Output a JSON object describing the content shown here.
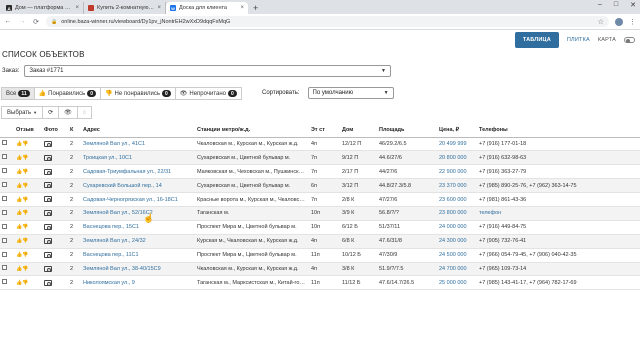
{
  "browser": {
    "tabs": [
      {
        "title": "Дом — платформа для просмотра",
        "color": "#2b2b2b",
        "glyph": "Д",
        "active": false
      },
      {
        "title": "Купить 2-комнатную квартиру",
        "color": "#c0392b",
        "glyph": "",
        "active": false
      },
      {
        "title": "Доска для клиента",
        "color": "#1a73e8",
        "glyph": "W",
        "active": true
      }
    ],
    "new_tab": "+",
    "url": "online.baza-winner.ru/viewboard/Dy1pv_jNontrEH2wXxD9dqqFxMqG",
    "window_controls": [
      "–",
      "□",
      "✕"
    ]
  },
  "nav": {
    "table_label": "ТАБЛИЦА",
    "tile_label": "ПЛИТКА",
    "map_label": "КАРТА"
  },
  "page_title": "СПИСОК ОБЪЕКТОВ",
  "order": {
    "label": "Заказ:",
    "value": "Заказ #1771"
  },
  "filters": [
    {
      "label": "Все",
      "count": "11",
      "icon": ""
    },
    {
      "label": "Понравились",
      "count": "0",
      "icon": "thumbs-up-icon"
    },
    {
      "label": "Не понравились",
      "count": "0",
      "icon": "thumbs-down-icon"
    },
    {
      "label": "Непрочитано",
      "count": "0",
      "icon": "eye-icon"
    }
  ],
  "sort": {
    "label": "Сортировать:",
    "value": "По умолчанию"
  },
  "actions": {
    "select_label": "Выбрать"
  },
  "table": {
    "headers": [
      "",
      "Отзыв",
      "Фото",
      "К",
      "Адрес",
      "Станции метро/ж.д.",
      "Эт ст",
      "Дом",
      "Площадь",
      "Цена, ₽",
      "Телефоны"
    ],
    "rows": [
      {
        "k": "2",
        "address": "Земляной Вал ул., 41С1",
        "metro": "Чкаловская м., Курская м., Курская ж.д.",
        "floor": "4п",
        "house": "12/12 П",
        "area": "46/29.2/6.5",
        "price": "20 499 999",
        "phones": "+7 (916) 177-01-18"
      },
      {
        "k": "2",
        "address": "Троицкая ул., 10С1",
        "metro": "Сухаревская м., Цветной бульвар м.",
        "floor": "7п",
        "house": "9/12 П",
        "area": "44.6/27/6",
        "price": "20 800 000",
        "phones": "+7 (916) 632-98-63"
      },
      {
        "k": "2",
        "address": "Садовая-Триумфальная ул., 22/31",
        "metro": "Маяковская м., Чеховская м., Пушкинская м.",
        "floor": "7п",
        "house": "2/17 П",
        "area": "44/27/6",
        "price": "22 900 000",
        "phones": "+7 (916) 363-27-79"
      },
      {
        "k": "2",
        "address": "Сухаревский Большой пер., 14",
        "metro": "Сухаревская м., Цветной бульвар м.",
        "floor": "6п",
        "house": "3/12 П",
        "area": "44.8/27.3/5.8",
        "price": "23 370 000",
        "phones": "+7 (985) 890-25-76, +7 (962) 363-14-75"
      },
      {
        "k": "2",
        "address": "Садовая-Черногрязская ул., 16-18С1",
        "metro": "Красные ворота м., Курская м., Чкаловская м.",
        "floor": "7п",
        "house": "2/8 К",
        "area": "47/27/6",
        "price": "23 600 000",
        "phones": "+7 (981) 861-43-36"
      },
      {
        "k": "2",
        "address": "Земляной Вал ул., 52/16С2",
        "metro": "Таганская м.",
        "floor": "10п",
        "house": "3/9 К",
        "area": "56.8/?/?",
        "price": "23 800 000",
        "phones": "телефон"
      },
      {
        "k": "2",
        "address": "Васнецова пер., 15С1",
        "metro": "Проспект Мира м., Цветной бульвар м.",
        "floor": "10п",
        "house": "6/12 Б",
        "area": "51/37/11",
        "price": "24 000 000",
        "phones": "+7 (916) 449-84-75"
      },
      {
        "k": "2",
        "address": "Земляной Вал ул., 24/32",
        "metro": "Курская м., Чкаловская м., Курская ж.д.",
        "floor": "4п",
        "house": "6/8 К",
        "area": "47.6/31/8",
        "price": "24 300 000",
        "phones": "+7 (905) 732-76-41"
      },
      {
        "k": "2",
        "address": "Васнецова пер., 11С1",
        "metro": "Проспект Мира м., Цветной бульвар м.",
        "floor": "11п",
        "house": "10/12 Б",
        "area": "47/30/9",
        "price": "24 500 000",
        "phones": "+7 (966) 054-79-45, +7 (906) 040-42-35"
      },
      {
        "k": "2",
        "address": "Земляной Вал ул., 38-40/15С9",
        "metro": "Чкаловская м., Курская м., Курская ж.д.",
        "floor": "4п",
        "house": "3/8 К",
        "area": "51.9/?/7.5",
        "price": "24 700 000",
        "phones": "+7 (965) 109-73-14"
      },
      {
        "k": "2",
        "address": "Николоямская ул., 9",
        "metro": "Таганская м., Марксистская м., Китай-город м.",
        "floor": "11п",
        "house": "11/12 Б",
        "area": "47.6/14.7/26.5",
        "price": "25 000 000",
        "phones": "+7 (985) 143-41-17, +7 (964) 782-17-69"
      }
    ]
  }
}
